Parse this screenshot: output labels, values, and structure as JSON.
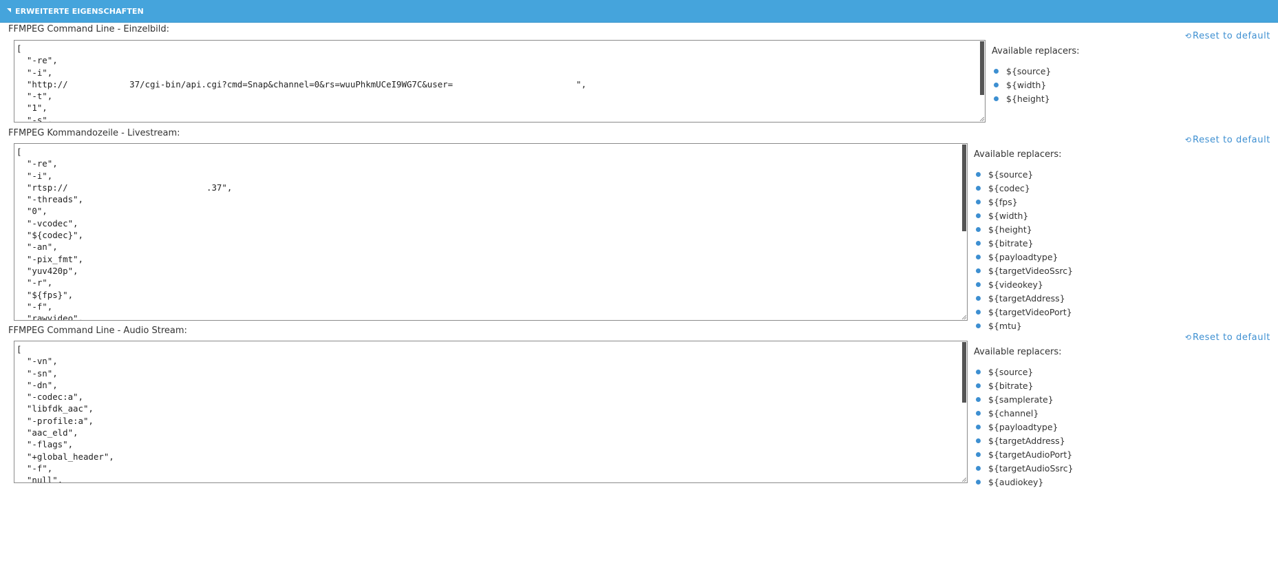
{
  "header": {
    "title": "ERWEITERTE EIGENSCHAFTEN"
  },
  "reset_label": "Reset to default",
  "sections": [
    {
      "label": "FFMPEG Command Line - Einzelbild:",
      "editor_text": "[\n  \"-re\",\n  \"-i\",\n  \"http://            37/cgi-bin/api.cgi?cmd=Snap&channel=0&rs=wuuPhkmUCeI9WG7C&user=                        \",\n  \"-t\",\n  \"1\",\n  \"-s\",\n  \"${width}x${height}\",",
      "replacers_title": "Available replacers:",
      "replacers": [
        "${source}",
        "${width}",
        "${height}"
      ]
    },
    {
      "label": "FFMPEG Kommandozeile - Livestream:",
      "editor_text": "[\n  \"-re\",\n  \"-i\",\n  \"rtsp://                           .37\",\n  \"-threads\",\n  \"0\",\n  \"-vcodec\",\n  \"${codec}\",\n  \"-an\",\n  \"-pix_fmt\",\n  \"yuv420p\",\n  \"-r\",\n  \"${fps}\",\n  \"-f\",\n  \"rawvideo\",\n  \"-tune\",\n  \"zerolatency\",\n  \"-vf\",",
      "replacers_title": "Available replacers:",
      "replacers": [
        "${source}",
        "${codec}",
        "${fps}",
        "${width}",
        "${height}",
        "${bitrate}",
        "${payloadtype}",
        "${targetVideoSsrc}",
        "${videokey}",
        "${targetAddress}",
        "${targetVideoPort}",
        "${mtu}"
      ]
    },
    {
      "label": "FFMPEG Command Line - Audio Stream:",
      "editor_text": "[\n  \"-vn\",\n  \"-sn\",\n  \"-dn\",\n  \"-codec:a\",\n  \"libfdk_aac\",\n  \"-profile:a\",\n  \"aac_eld\",\n  \"-flags\",\n  \"+global_header\",\n  \"-f\",\n  \"null\",\n  \"-ar\",\n  \"${samplerate}k\",",
      "replacers_title": "Available replacers:",
      "replacers": [
        "${source}",
        "${bitrate}",
        "${samplerate}",
        "${channel}",
        "${payloadtype}",
        "${targetAddress}",
        "${targetAudioPort}",
        "${targetAudioSsrc}",
        "${audiokey}"
      ]
    }
  ]
}
